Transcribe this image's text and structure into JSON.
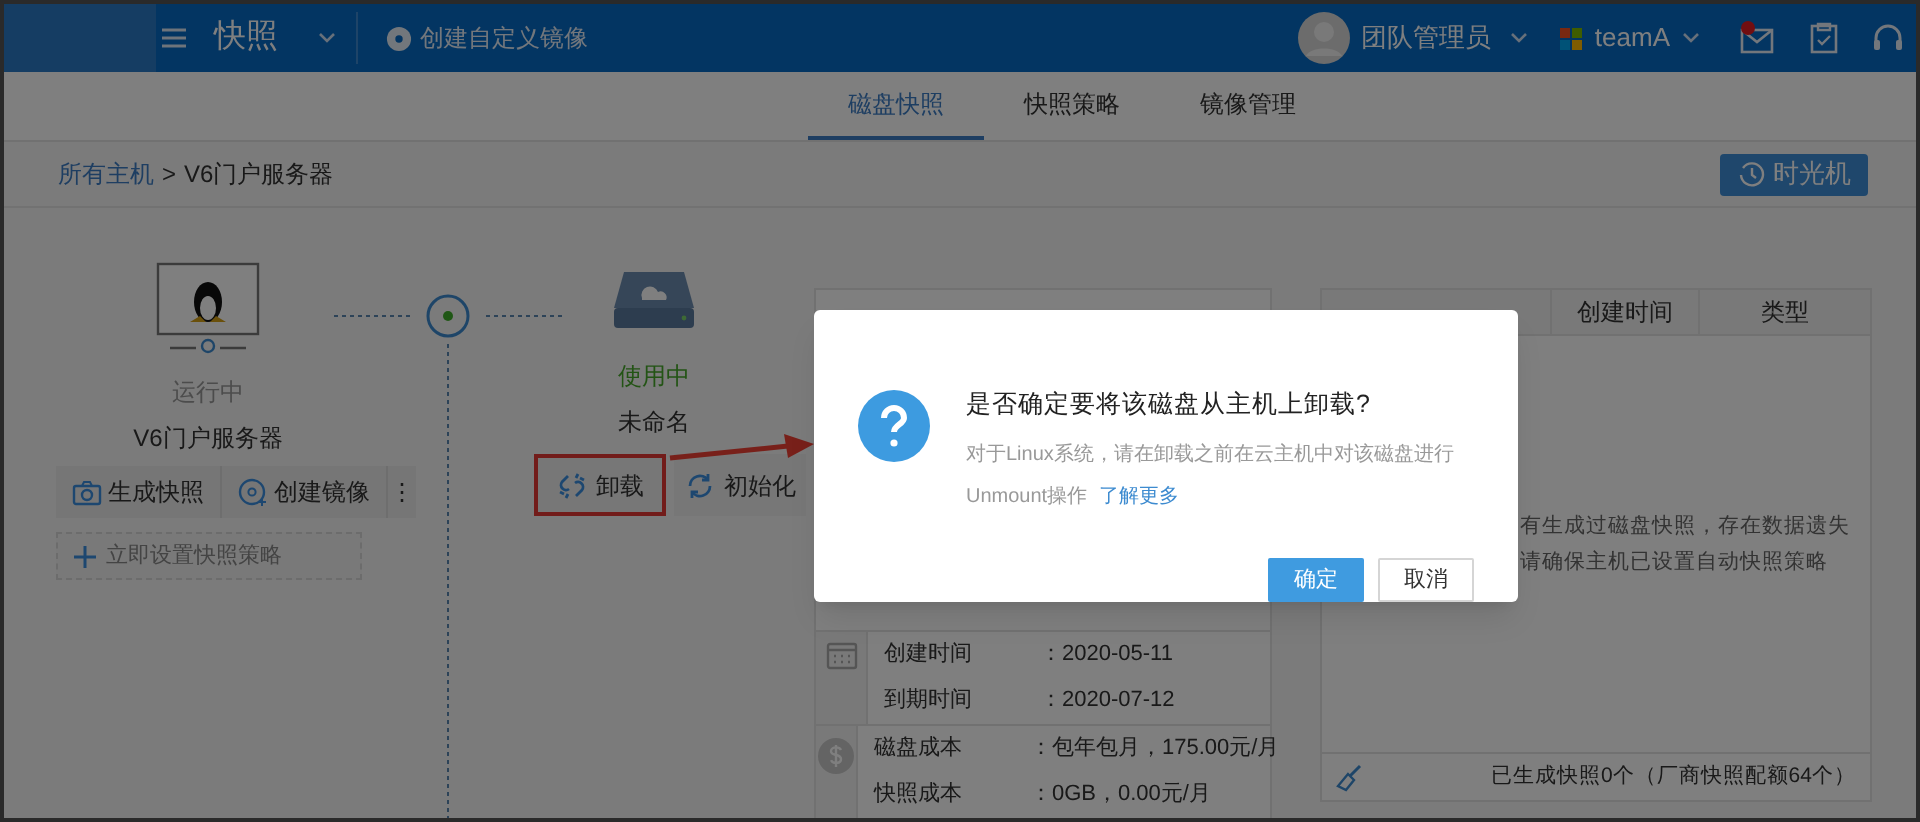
{
  "header": {
    "menu_title": "快照",
    "create_image": "创建自定义镜像",
    "user": "团队管理员",
    "team": "teamA",
    "unread": true
  },
  "tabs": [
    {
      "label": "磁盘快照",
      "selected": true
    },
    {
      "label": "快照策略",
      "selected": false
    },
    {
      "label": "镜像管理",
      "selected": false
    }
  ],
  "breadcrumb": {
    "link": "所有主机",
    "separator": ">",
    "current": "V6门户服务器"
  },
  "time_machine_button": "时光机",
  "host": {
    "status": "运行中",
    "name": "V6门户服务器",
    "actions": [
      "生成快照",
      "创建镜像"
    ],
    "more": "⋮",
    "policy_button": "立即设置快照策略"
  },
  "disk": {
    "status": "使用中",
    "name": "未命名",
    "actions": [
      {
        "label": "卸载",
        "kind": "unmount",
        "highlighted": true
      },
      {
        "label": "初始化",
        "kind": "init",
        "highlighted": false
      }
    ]
  },
  "info_groups": [
    {
      "kind": "date",
      "rows": [
        {
          "label": "创建时间",
          "colon": "：",
          "value": "2020-05-11"
        },
        {
          "label": "到期时间",
          "colon": "：",
          "value": "2020-07-12"
        }
      ]
    },
    {
      "kind": "cost",
      "rows": [
        {
          "label": "磁盘成本",
          "colon": "：",
          "value": "包年包月，175.00元/月"
        },
        {
          "label": "快照成本",
          "colon": "：",
          "value": "0GB，0.00元/月"
        }
      ]
    }
  ],
  "snapshots": {
    "columns": [
      "创建时间",
      "类型"
    ],
    "empty_message": [
      "有生成过磁盘快照，存在数据遗失",
      "请确保主机已设置自动快照策略"
    ],
    "footer": "已生成快照0个（厂商快照配额64个）"
  },
  "dialog": {
    "title": "是否确定要将该磁盘从主机上卸载?",
    "message": "对于Linux系统，请在卸载之前在云主机中对该磁盘进行",
    "message_2": "Unmount操作",
    "link": "了解更多",
    "buttons": [
      {
        "label": "确定",
        "primary": true
      },
      {
        "label": "取消",
        "primary": false
      }
    ]
  }
}
